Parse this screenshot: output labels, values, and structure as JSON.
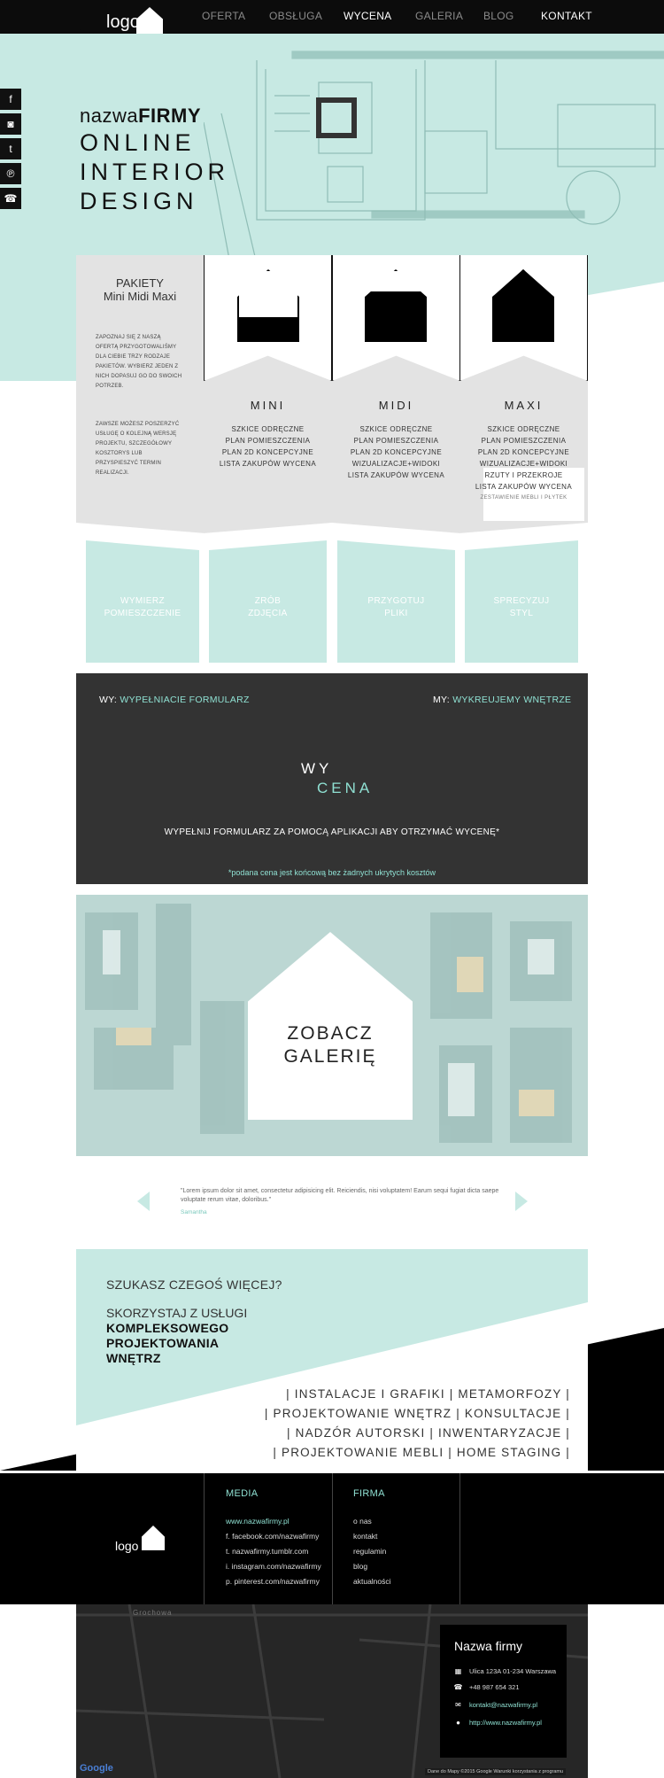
{
  "nav": {
    "logo": "logo",
    "items": [
      {
        "label": "OFERTA",
        "active": false
      },
      {
        "label": "OBSŁUGA",
        "active": false
      },
      {
        "label": "WYCENA",
        "active": true
      },
      {
        "label": "GALERIA",
        "active": false
      },
      {
        "label": "BLOG",
        "active": false
      },
      {
        "label": "KONTAKT",
        "active": true
      }
    ]
  },
  "social": [
    "facebook-icon",
    "instagram-icon",
    "tumblr-icon",
    "pinterest-icon",
    "phone-icon"
  ],
  "hero": {
    "brand_light": "nazwa",
    "brand_bold": "FIRMY",
    "line1": "ONLINE",
    "line2": "INTERIOR",
    "line3": "DESIGN"
  },
  "packages": {
    "title1": "PAKIETY",
    "title2": "Mini Midi Maxi",
    "desc1": "ZAPOZNAJ SIĘ Z NASZĄ OFERTĄ PRZYGOTOWALIŚMY DLA CIEBIE TRZY RODZAJE PAKIETÓW. WYBIERZ JEDEN Z NICH DOPASUJ GO DO SWOICH POTRZEB.",
    "desc2": "ZAWSZE MOŻESZ POSZERZYĆ USŁUGĘ O KOLEJNĄ WERSJĘ PROJEKTU, SZCZEGÓŁOWY KOSZTORYS LUB PRZYSPIESZYĆ TERMIN REALIZACJI.",
    "items": [
      {
        "name": "MINI",
        "features": [
          "SZKICE ODRĘCZNE",
          "PLAN POMIESZCZENIA",
          "PLAN 2D KONCEPCYJNE",
          "LISTA ZAKUPÓW WYCENA"
        ]
      },
      {
        "name": "MIDI",
        "features": [
          "SZKICE ODRĘCZNE",
          "PLAN POMIESZCZENIA",
          "PLAN 2D KONCEPCYJNE",
          "WIZUALIZACJE+WIDOKI",
          "LISTA ZAKUPÓW WYCENA"
        ]
      },
      {
        "name": "MAXI",
        "features": [
          "SZKICE ODRĘCZNE",
          "PLAN POMIESZCZENIA",
          "PLAN 2D KONCEPCYJNE",
          "WIZUALIZACJE+WIDOKI",
          "RZUTY I PRZEKROJE",
          "LISTA ZAKUPÓW WYCENA",
          "ZESTAWIENIE MEBLI I PŁYTEK"
        ]
      }
    ]
  },
  "steps": [
    {
      "line1": "WYMIERZ",
      "line2": "POMIESZCZENIE"
    },
    {
      "line1": "ZRÓB",
      "line2": "ZDJĘCIA"
    },
    {
      "line1": "PRZYGOTUJ",
      "line2": "PLIKI"
    },
    {
      "line1": "SPRECYZUJ",
      "line2": "STYL"
    }
  ],
  "form": {
    "left_prefix": "WY:",
    "left_text": "WYPEŁNIACIE FORMULARZ",
    "right_prefix": "MY:",
    "right_text": "WYKREUJEMY WNĘTRZE",
    "logo_top": "WY",
    "logo_bottom": "CENA",
    "cta": "WYPEŁNIJ FORMULARZ ZA POMOCĄ APLIKACJI ABY OTRZYMAĆ WYCENĘ*",
    "note": "*podana cena jest końcową bez żadnych ukrytych kosztów"
  },
  "gallery": {
    "line1": "ZOBACZ",
    "line2": "GALERIĘ"
  },
  "testimonial": {
    "quote": "\"Lorem ipsum dolor sit amet, consectetur adipisicing elit. Reiciendis, nisi voluptatem! Earum sequi fugiat dicta saepe voluptate rerum vitae, doloribus.\"",
    "author": "Samantha"
  },
  "services": {
    "question": "SZUKASZ CZEGOŚ WIĘCEJ?",
    "sub": "SKORZYSTAJ Z USŁUGI",
    "bold1": "KOMPLEKSOWEGO",
    "bold2": "PROJEKTOWANIA",
    "bold3": "WNĘTRZ",
    "lines": [
      "| INSTALACJE I GRAFIKI | METAMORFOZY |",
      "| PROJEKTOWANIE WNĘTRZ | KONSULTACJE |",
      "| NADZÓR AUTORSKI | INWENTARYZACJE |",
      "| PROJEKTOWANIE MEBLI | HOME STAGING |"
    ]
  },
  "footer": {
    "logo": "logo",
    "media_title": "MEDIA",
    "media_links": [
      "www.nazwafirmy.pl",
      "f. facebook.com/nazwafirmy",
      "t. nazwafirmy.tumblr.com",
      "i. instagram.com/nazwafirmy",
      "p. pinterest.com/nazwafirmy"
    ],
    "firma_title": "FIRMA",
    "firma_links": [
      "o nas",
      "kontakt",
      "regulamin",
      "blog",
      "aktualności"
    ]
  },
  "map": {
    "street": "Grochowa",
    "company": "Nazwa firmy",
    "address": "Ulica 123A 01-234 Warszawa",
    "phone": "+48 987 654 321",
    "email": "kontakt@nazwafirmy.pl",
    "website": "http://www.nazwafirmy.pl",
    "google": "Google",
    "footer_note": "Dane do Mapy ©2015 Google   Warunki korzystania z programu"
  },
  "colors": {
    "mint": "#c7e9e3",
    "accent": "#8fe0d2",
    "dark": "#333333",
    "black": "#000000"
  }
}
